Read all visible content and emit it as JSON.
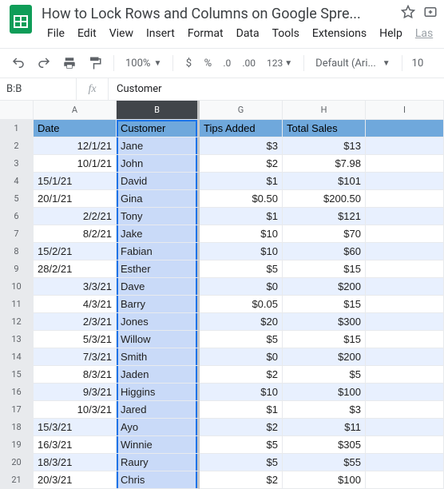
{
  "doc": {
    "title": "How to Lock Rows and Columns on Google Spre..."
  },
  "menus": [
    "File",
    "Edit",
    "View",
    "Insert",
    "Format",
    "Data",
    "Tools",
    "Extensions",
    "Help",
    "Las"
  ],
  "toolbar": {
    "zoom": "100%",
    "font": "Default (Ari...",
    "font_size": "10"
  },
  "name_box": "B:B",
  "fx_label": "fx",
  "formula": "Customer",
  "columns": [
    {
      "key": "A",
      "label": "A",
      "w": "col-A"
    },
    {
      "key": "B",
      "label": "B",
      "w": "col-B",
      "selected": true
    },
    {
      "key": "G",
      "label": "G",
      "w": "col-G"
    },
    {
      "key": "H",
      "label": "H",
      "w": "col-H"
    },
    {
      "key": "I",
      "label": "I",
      "w": "col-I"
    }
  ],
  "header_row": {
    "A": "Date",
    "B": "Customer",
    "G": "Tips Added",
    "H": "Total Sales",
    "I": ""
  },
  "rows": [
    {
      "n": 2,
      "band": true,
      "A": "12/1/21",
      "B": "Jane",
      "G": "$3",
      "H": "$13"
    },
    {
      "n": 3,
      "band": false,
      "A": "10/1/21",
      "B": "John",
      "G": "$2",
      "H": "$7.98"
    },
    {
      "n": 4,
      "band": true,
      "A": "15/1/21",
      "B": "David",
      "G": "$1",
      "H": "$101",
      "Aleft": true
    },
    {
      "n": 5,
      "band": false,
      "A": "20/1/21",
      "B": "Gina",
      "G": "$0.50",
      "H": "$200.50",
      "Aleft": true
    },
    {
      "n": 6,
      "band": true,
      "A": "2/2/21",
      "B": "Tony",
      "G": "$1",
      "H": "$121"
    },
    {
      "n": 7,
      "band": false,
      "A": "8/2/21",
      "B": "Jake",
      "G": "$10",
      "H": "$70"
    },
    {
      "n": 8,
      "band": true,
      "A": "15/2/21",
      "B": "Fabian",
      "G": "$10",
      "H": "$60",
      "Aleft": true
    },
    {
      "n": 9,
      "band": false,
      "A": "28/2/21",
      "B": "Esther",
      "G": "$5",
      "H": "$15",
      "Aleft": true
    },
    {
      "n": 10,
      "band": true,
      "A": "3/3/21",
      "B": "Dave",
      "G": "$0",
      "H": "$200"
    },
    {
      "n": 11,
      "band": false,
      "A": "4/3/21",
      "B": "Barry",
      "G": "$0.05",
      "H": "$15"
    },
    {
      "n": 12,
      "band": true,
      "A": "2/3/21",
      "B": "Jones",
      "G": "$20",
      "H": "$300"
    },
    {
      "n": 13,
      "band": false,
      "A": "5/3/21",
      "B": "Willow",
      "G": "$5",
      "H": "$15"
    },
    {
      "n": 14,
      "band": true,
      "A": "7/3/21",
      "B": "Smith",
      "G": "$0",
      "H": "$200"
    },
    {
      "n": 15,
      "band": false,
      "A": "8/3/21",
      "B": "Jaden",
      "G": "$2",
      "H": "$5"
    },
    {
      "n": 16,
      "band": true,
      "A": "9/3/21",
      "B": "Higgins",
      "G": "$10",
      "H": "$100"
    },
    {
      "n": 17,
      "band": false,
      "A": "10/3/21",
      "B": "Jared",
      "G": "$1",
      "H": "$3"
    },
    {
      "n": 18,
      "band": true,
      "A": "15/3/21",
      "B": "Ayo",
      "G": "$2",
      "H": "$11",
      "Aleft": true
    },
    {
      "n": 19,
      "band": false,
      "A": "16/3/21",
      "B": "Winnie",
      "G": "$5",
      "H": "$305",
      "Aleft": true
    },
    {
      "n": 20,
      "band": true,
      "A": "18/3/21",
      "B": "Raury",
      "G": "$5",
      "H": "$55",
      "Aleft": true
    },
    {
      "n": 21,
      "band": false,
      "A": "20/3/21",
      "B": "Chris",
      "G": "$2",
      "H": "$100",
      "Aleft": true
    }
  ]
}
